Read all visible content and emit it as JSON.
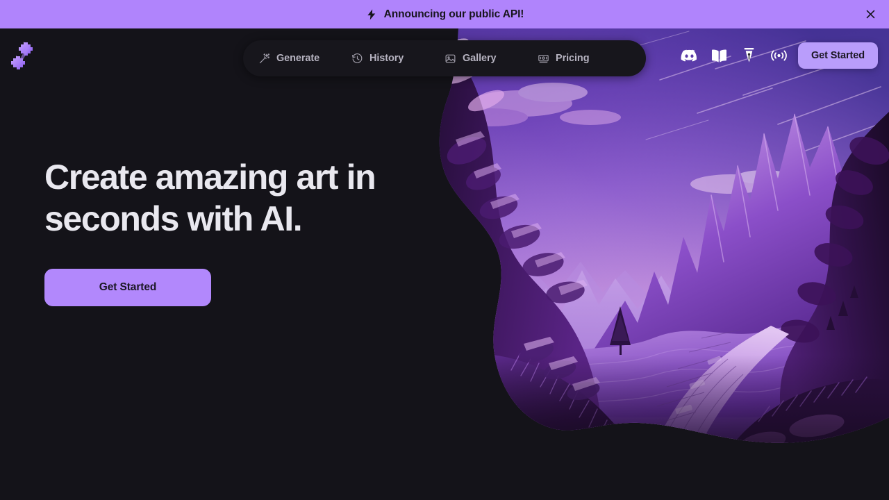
{
  "announcement": {
    "icon": "lightning-bolt-icon",
    "text": "Announcing our public API!",
    "close_icon": "close-icon",
    "bg_color": "#b084fc",
    "text_color": "#17151d"
  },
  "header": {
    "logo": {
      "icon": "gear-logo-icon",
      "color": "#a977f5"
    },
    "nav": {
      "items": [
        {
          "label": "Generate",
          "icon": "magic-wand-icon"
        },
        {
          "label": "History",
          "icon": "clock-history-icon"
        },
        {
          "label": "Gallery",
          "icon": "image-icon"
        },
        {
          "label": "Pricing",
          "icon": "pricing-display-icon"
        }
      ],
      "bg_color": "#17161c",
      "text_color": "#b6b3c0"
    },
    "social_icons": [
      {
        "name": "discord-icon"
      },
      {
        "name": "book-docs-icon"
      },
      {
        "name": "pen-nib-icon"
      },
      {
        "name": "broadcast-signal-icon"
      }
    ],
    "cta": {
      "label": "Get Started",
      "bg_color": "#b99dfb",
      "text_color": "#1b1724"
    }
  },
  "hero": {
    "title": "Create amazing art in seconds with AI.",
    "cta": {
      "label": "Get Started",
      "bg_color": "#b288fc",
      "text_color": "#1b1724"
    },
    "artwork": {
      "name": "purple-mountain-landscape-artwork",
      "description": "Stylized purple fantasy mountain valley at dusk with a cobblestone path",
      "palette": {
        "sky_high": "#5b3fa8",
        "sky_mid": "#a06fd6",
        "sky_glow": "#f0cfe8",
        "mountain_far": "#a279d8",
        "mountain_mid": "#8a57c8",
        "mountain_near": "#5e2f96",
        "cliff_dark": "#35134f",
        "cliff_deep": "#23102f",
        "path_light": "#c69ce6",
        "highlight": "#e6c3f0"
      }
    }
  },
  "page": {
    "background_color": "#141319"
  }
}
